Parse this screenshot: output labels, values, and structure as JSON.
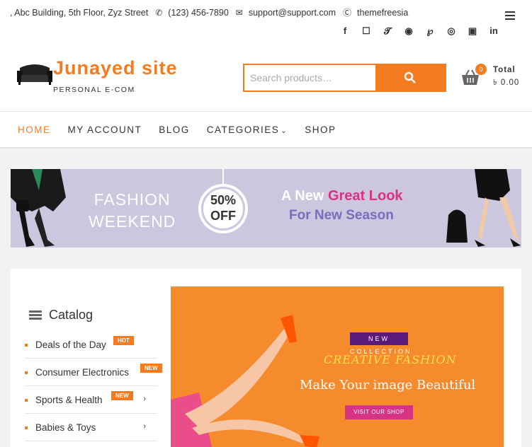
{
  "topbar": {
    "address": ", Abc Building, 5th Floor, Zyz Street",
    "phone": "(123) 456-7890",
    "email": "support@support.com",
    "skype": "themefreesia",
    "social_icons": [
      "facebook-icon",
      "instagram-icon",
      "twitter-icon",
      "google-plus-icon",
      "pinterest-icon",
      "dribbble-icon",
      "flickr-icon",
      "linkedin-icon"
    ]
  },
  "header": {
    "site_title": "Junayed site",
    "site_description": "PERSONAL E-COM",
    "search_placeholder": "Search products…",
    "cart_count": "0",
    "cart_total_label": "Total",
    "cart_total_value": "৳ 0.00"
  },
  "nav": {
    "items": [
      {
        "label": "HOME"
      },
      {
        "label": "MY ACCOUNT"
      },
      {
        "label": "BLOG"
      },
      {
        "label": "CATEGORIES"
      },
      {
        "label": "SHOP"
      }
    ]
  },
  "banner": {
    "line1": "FASHION",
    "line2": "WEEKEND",
    "offer1": "50%",
    "offer2": "OFF",
    "tag_a": "A New",
    "tag_b": "Great Look",
    "tag_c": "For New Season"
  },
  "catalog": {
    "title": "Catalog",
    "items": [
      {
        "label": "Deals of the Day",
        "badge": "HOT"
      },
      {
        "label": "Consumer Electronics",
        "badge": "NEW"
      },
      {
        "label": "Sports & Health",
        "badge": "NEW"
      },
      {
        "label": "Babies & Toys"
      }
    ]
  },
  "promo": {
    "tag": "NEW COLLECTION",
    "headline": "CREATIVE FASHION",
    "subline": "Make Your image Beautiful",
    "button": "VISIT OUR SHOP"
  },
  "colors": {
    "accent": "#f47b20",
    "pink": "#d63384",
    "banner_bg": "#ccc6df"
  }
}
